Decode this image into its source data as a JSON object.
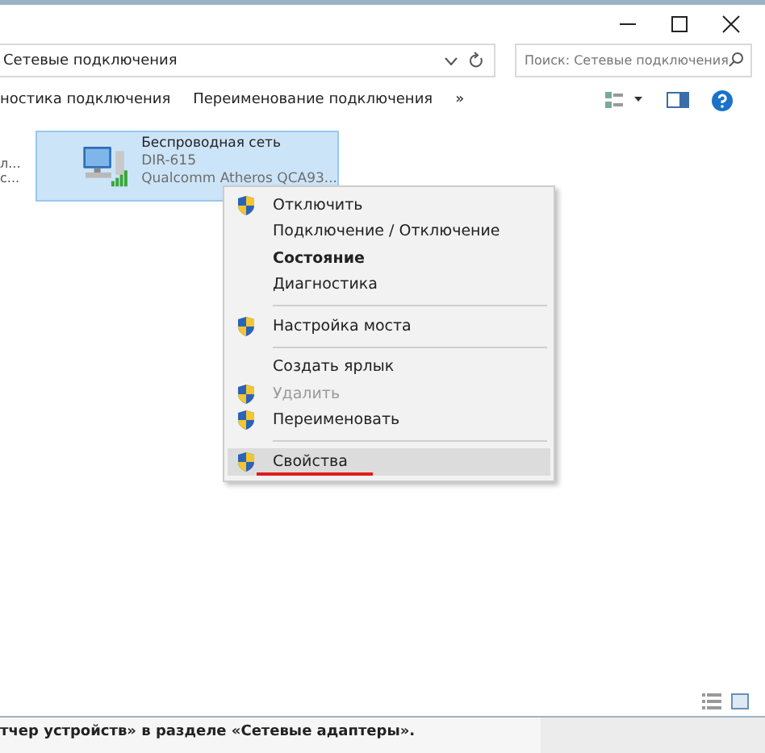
{
  "address_bar": {
    "path": "Сетевые подключения",
    "search": {
      "placeholder": "Поиск: Сетевые подключения"
    }
  },
  "toolbar": {
    "commands": [
      "ностика подключения",
      "Переименование подключения"
    ],
    "overflow": "»"
  },
  "side_items": [
    {
      "line1": "л...",
      "line2": "с..."
    }
  ],
  "connection": {
    "name": "Беспроводная сеть",
    "network": "DIR-615",
    "adapter": "Qualcomm Atheros QCA93...",
    "selected": true
  },
  "context_menu": [
    {
      "kind": "item",
      "label": "Отключить",
      "shield": true,
      "bold": false,
      "disabled": false,
      "selected": false,
      "underlined": false
    },
    {
      "kind": "item",
      "label": "Подключение / Отключение",
      "shield": false,
      "bold": false,
      "disabled": false,
      "selected": false,
      "underlined": false
    },
    {
      "kind": "item",
      "label": "Состояние",
      "shield": false,
      "bold": true,
      "disabled": false,
      "selected": false,
      "underlined": false
    },
    {
      "kind": "item",
      "label": "Диагностика",
      "shield": false,
      "bold": false,
      "disabled": false,
      "selected": false,
      "underlined": false
    },
    {
      "kind": "separator"
    },
    {
      "kind": "item",
      "label": "Настройка моста",
      "shield": true,
      "bold": false,
      "disabled": false,
      "selected": false,
      "underlined": false
    },
    {
      "kind": "separator"
    },
    {
      "kind": "item",
      "label": "Создать ярлык",
      "shield": false,
      "bold": false,
      "disabled": false,
      "selected": false,
      "underlined": false
    },
    {
      "kind": "item",
      "label": "Удалить",
      "shield": true,
      "bold": false,
      "disabled": true,
      "selected": false,
      "underlined": false
    },
    {
      "kind": "item",
      "label": "Переименовать",
      "shield": true,
      "bold": false,
      "disabled": false,
      "selected": false,
      "underlined": false
    },
    {
      "kind": "separator"
    },
    {
      "kind": "item",
      "label": "Свойства",
      "shield": true,
      "bold": false,
      "disabled": false,
      "selected": true,
      "underlined": true
    }
  ],
  "caption": "тчер устройств» в разделе «Сетевые адаптеры»."
}
